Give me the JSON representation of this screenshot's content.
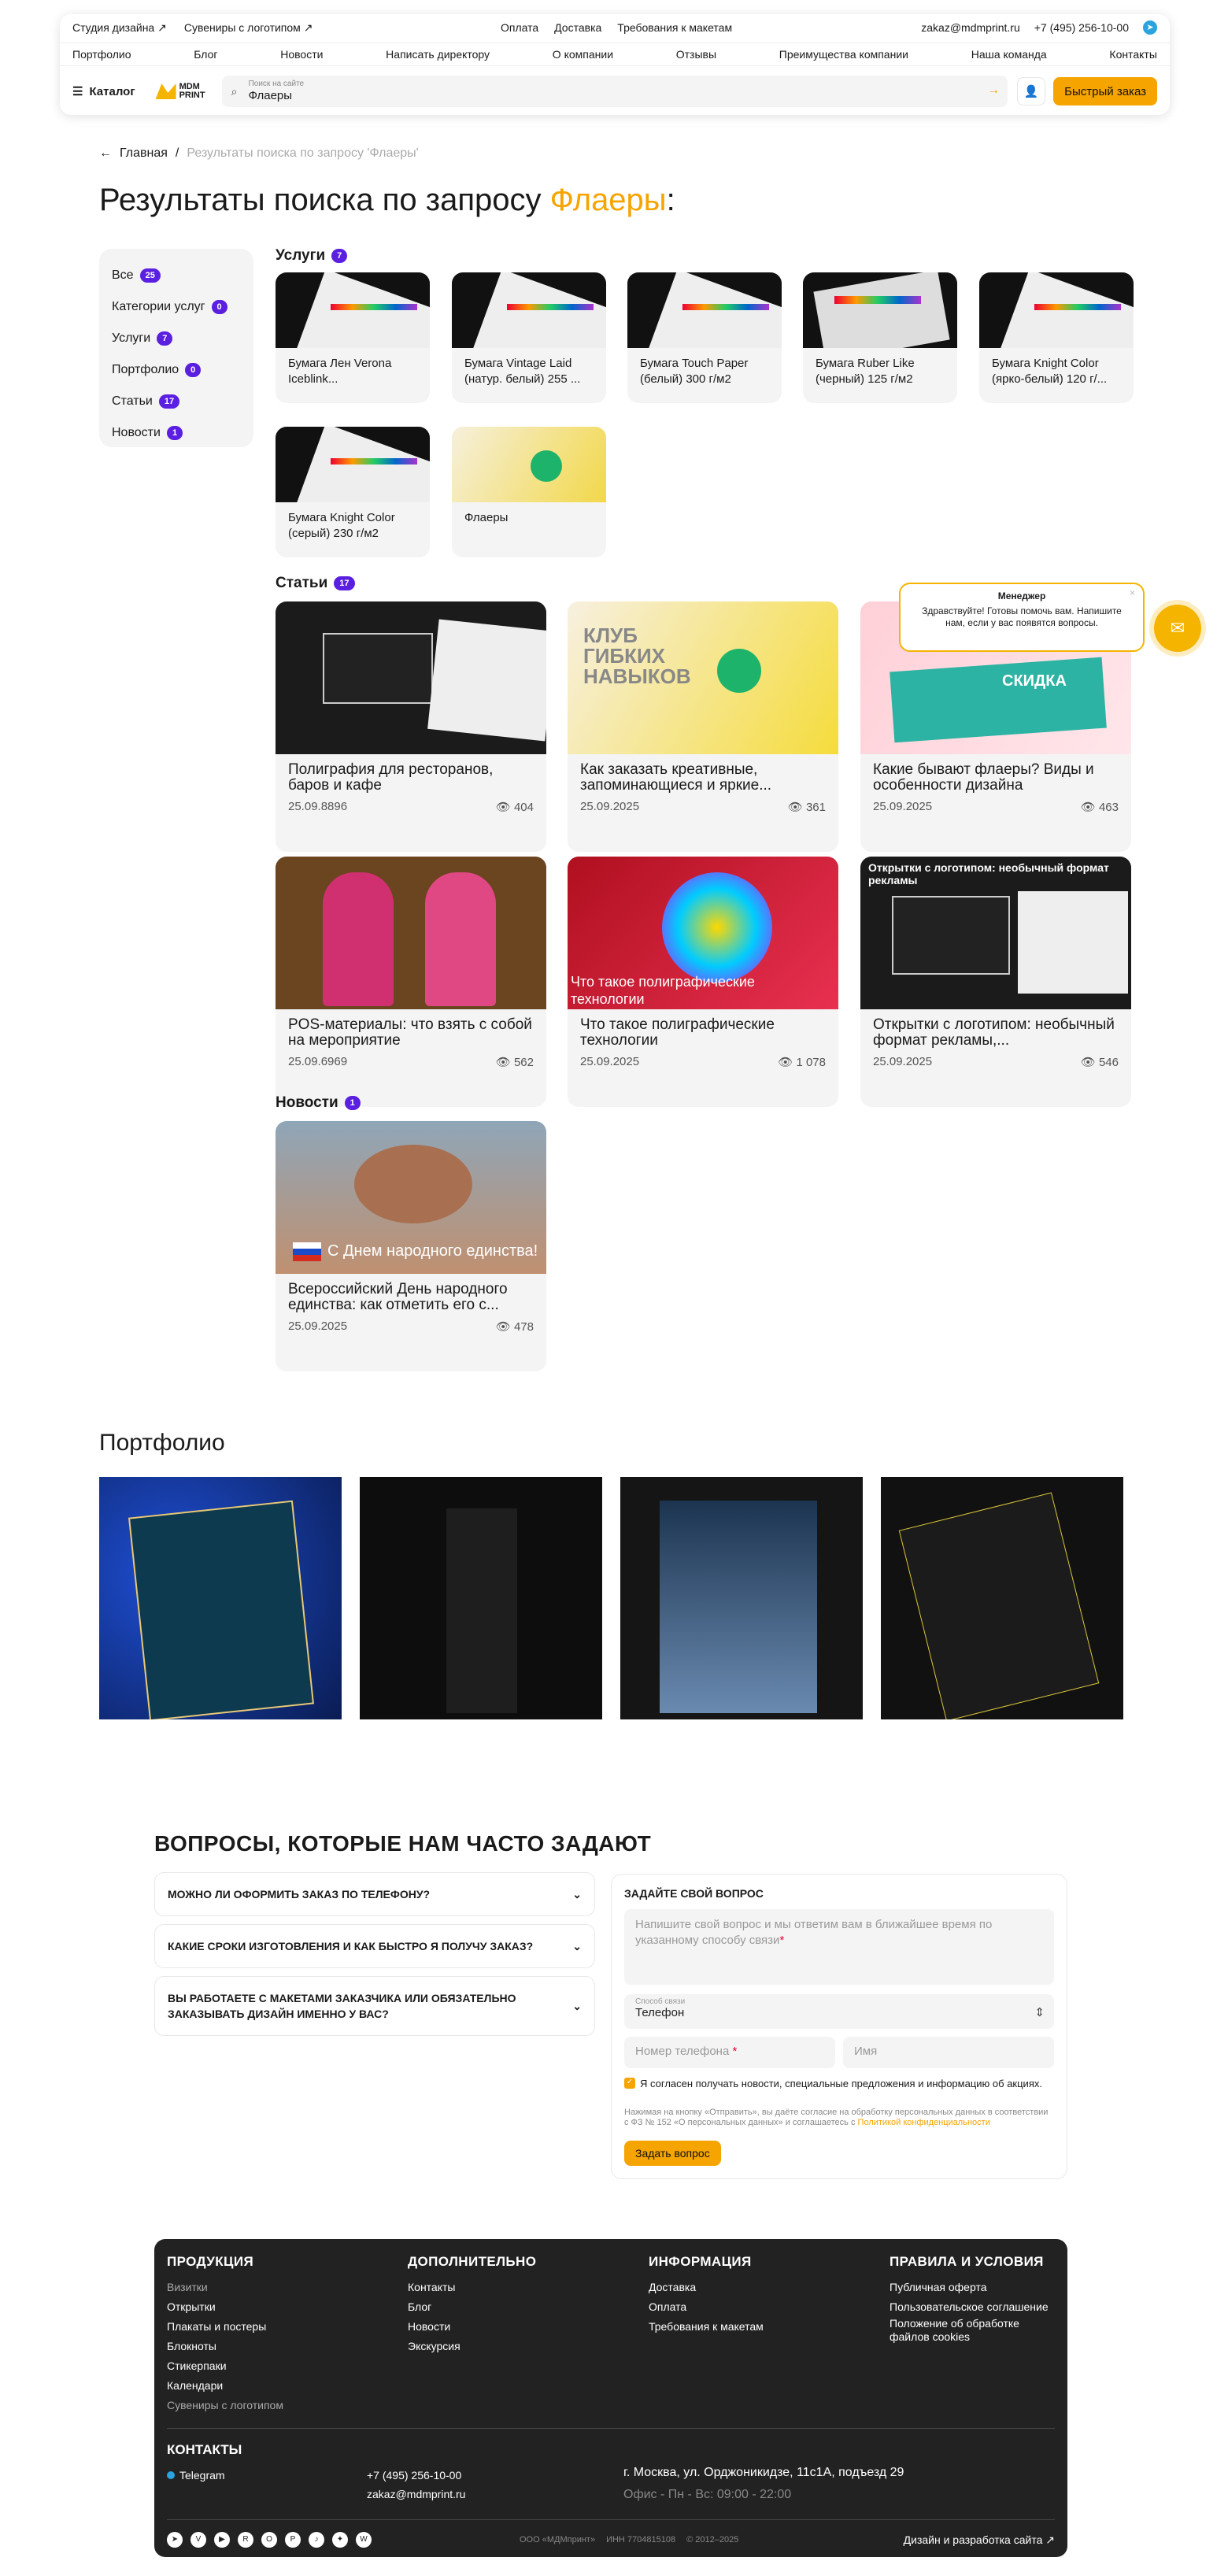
{
  "header": {
    "top_left": [
      "Студия дизайна ↗",
      "Сувениры с логотипом ↗"
    ],
    "top_center": [
      "Оплата",
      "Доставка",
      "Требования к макетам"
    ],
    "email": "zakaz@mdmprint.ru",
    "phone": "+7 (495) 256-10-00",
    "nav": [
      "Портфолио",
      "Блог",
      "Новости",
      "Написать директору",
      "О компании",
      "Отзывы",
      "Преимущества компании",
      "Наша команда",
      "Контакты"
    ],
    "catalog": "Каталог",
    "logo": "MDM PRINT",
    "search_placeholder": "Поиск на сайте",
    "search_value": "Флаеры",
    "quick_order": "Быстрый заказ"
  },
  "breadcrumb": {
    "home": "Главная",
    "sep": "/",
    "current": "Результаты поиска по запросу 'Флаеры'"
  },
  "title": {
    "prefix": "Результаты поиска по запросу ",
    "query": "Флаеры",
    "suffix": ":"
  },
  "sidebar": [
    {
      "label": "Все",
      "count": "25"
    },
    {
      "label": "Категории услуг",
      "count": "0"
    },
    {
      "label": "Услуги",
      "count": "7"
    },
    {
      "label": "Портфолио",
      "count": "0"
    },
    {
      "label": "Статьи",
      "count": "17"
    },
    {
      "label": "Новости",
      "count": "1"
    }
  ],
  "services": {
    "label": "Услуги",
    "count": "7",
    "items": [
      "Бумага Лен Verona Iceblink...",
      "Бумага Vintage Laid (натур. белый) 255 ...",
      "Бумага Touch Paper (белый) 300 г/м2",
      "Бумага Ruber Like (черный) 125 г/м2",
      "Бумага Knight Color (ярко-белый) 120 г/...",
      "Бумага Knight Color (серый) 230 г/м2",
      "Флаеры"
    ]
  },
  "articles": {
    "label": "Статьи",
    "count": "17",
    "items": [
      {
        "title": "Полиграфия для ресторанов, баров и кафе",
        "date": "25.09.8896",
        "views": "404"
      },
      {
        "title": "Как заказать креативные, запоминающиеся и яркие...",
        "date": "25.09.2025",
        "views": "361"
      },
      {
        "title": "Какие бывают флаеры? Виды и особенности дизайна",
        "date": "25.09.2025",
        "views": "463"
      },
      {
        "title": "POS-материалы: что взять с собой на мероприятие",
        "date": "25.09.6969",
        "views": "562"
      },
      {
        "title": "Что такое полиграфические технологии",
        "date": "25.09.2025",
        "views": "1 078"
      },
      {
        "title": "Открытки с логотипом: необычный формат рекламы,...",
        "date": "25.09.2025",
        "views": "546"
      }
    ],
    "img_texts": [
      "КЛУБ ГИБКИХ НАВЫКОВ",
      "СКИДКА",
      "Что такое полиграфические технологии",
      "Открытки с логотипом: необычный формат рекламы"
    ]
  },
  "news": {
    "label": "Новости",
    "count": "1",
    "items": [
      {
        "title": "Всероссийский День народного единства: как отметить его с...",
        "date": "25.09.2025",
        "views": "478",
        "img_text": "С Днем народного единства!"
      }
    ]
  },
  "portfolio": {
    "title": "Портфолио"
  },
  "faq": {
    "title": "ВОПРОСЫ, КОТОРЫЕ НАМ ЧАСТО ЗАДАЮТ",
    "items": [
      "МОЖНО ЛИ ОФОРМИТЬ ЗАКАЗ ПО ТЕЛЕФОНУ?",
      "КАКИЕ СРОКИ ИЗГОТОВЛЕНИЯ И КАК БЫСТРО Я ПОЛУЧУ ЗАКАЗ?",
      "ВЫ РАБОТАЕТЕ С МАКЕТАМИ ЗАКАЗЧИКА ИЛИ ОБЯЗАТЕЛЬНО ЗАКАЗЫВАТЬ ДИЗАЙН ИМЕННО У ВАС?"
    ]
  },
  "form": {
    "title": "ЗАДАЙТЕ СВОЙ ВОПРОС",
    "question_ph": "Напишите свой вопрос и мы ответим вам в ближайшее время по указанному способу связи",
    "contact_label": "Способ связи",
    "contact_value": "Телефон",
    "phone_ph": "Номер телефона",
    "name_ph": "Имя",
    "consent": "Я согласен получать новости, специальные предложения и информацию об акциях.",
    "legal": "Нажимая на кнопку «Отправить», вы даёте согласие на обработку персональных данных в соответствии с ФЗ № 152 «О персональных данных» и соглашаетесь с",
    "legal_link": "Политикой конфиденциальности",
    "submit": "Задать вопрос"
  },
  "chat": {
    "title": "Менеджер",
    "text": "Здравствуйте! Готовы помочь вам. Напишите нам, если у вас появятся вопросы."
  },
  "footer": {
    "cols": [
      {
        "h": "ПРОДУКЦИЯ",
        "items": [
          "Визитки",
          "Открытки",
          "Плакаты и постеры",
          "Блокноты",
          "Стикерпаки",
          "Календари",
          "Сувениры с логотипом"
        ]
      },
      {
        "h": "ДОПОЛНИТЕЛЬНО",
        "items": [
          "Контакты",
          "Блог",
          "Новости",
          "Экскурсия"
        ]
      },
      {
        "h": "ИНФОРМАЦИЯ",
        "items": [
          "Доставка",
          "Оплата",
          "Требования к макетам"
        ]
      },
      {
        "h": "ПРАВИЛА И УСЛОВИЯ",
        "items": [
          "Публичная оферта",
          "Пользовательское соглашение",
          "Положение об обработке файлов cookies"
        ]
      }
    ],
    "contacts": "КОНТАКТЫ",
    "telegram": "Telegram",
    "phone": "+7 (495) 256-10-00",
    "email": "zakaz@mdmprint.ru",
    "address": "г. Москва, ул. Орджоникидзе, 11с1А, подъезд 29",
    "hours": "Офис - Пн - Вс: 09:00 - 22:00",
    "company": "ООО «МДМпринт»",
    "inn": "ИНН 7704815108",
    "years": "© 2012–2025",
    "dev": "Дизайн и разработка сайта ↗"
  },
  "colors": {
    "accent": "#f5a400",
    "badge": "#5a1fe0",
    "footer_bg": "#222222"
  }
}
